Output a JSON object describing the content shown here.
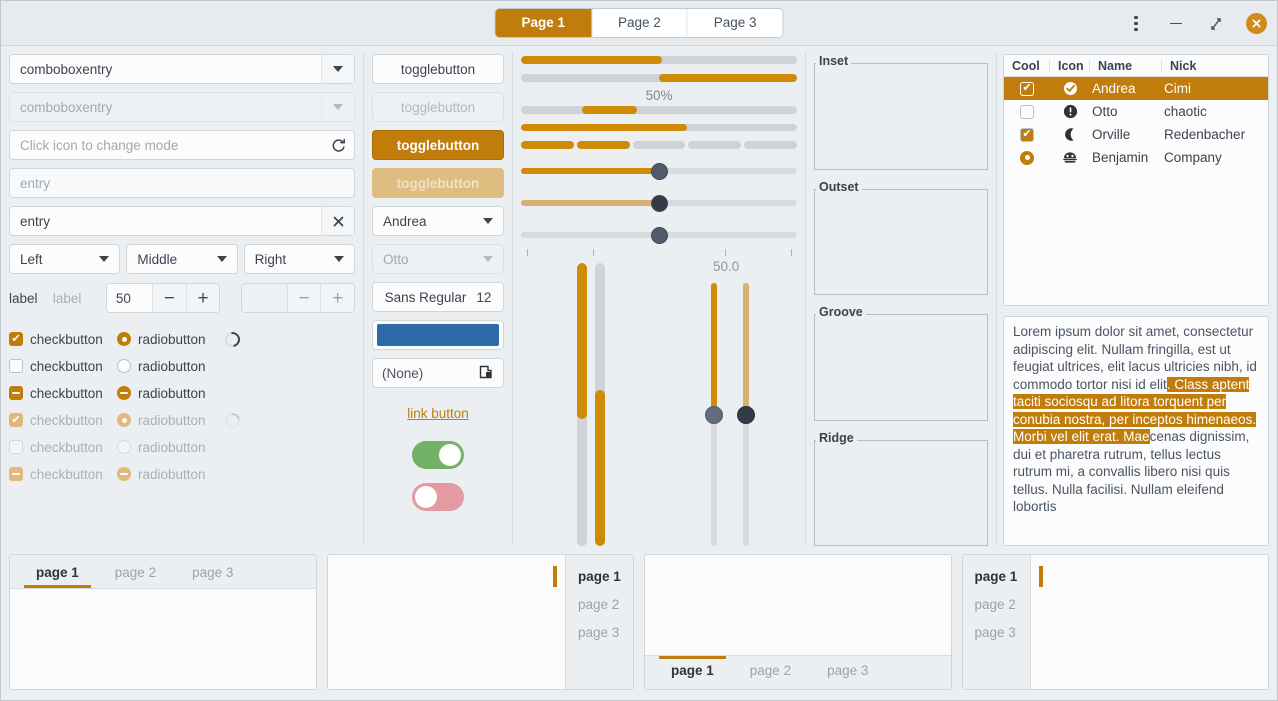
{
  "header": {
    "tabs": [
      {
        "label": "Page 1",
        "active": true
      },
      {
        "label": "Page 2",
        "active": false
      },
      {
        "label": "Page 3",
        "active": false
      }
    ],
    "menu_icon": "three-dots-icon",
    "minimize_icon": "minimize-icon",
    "restore_icon": "restore-icon",
    "close_icon": "close-icon"
  },
  "colors": {
    "accent": "#c17d0b",
    "accent_progress": "#cf8a08",
    "accent_faded": "#dfba7a",
    "window_bg": "#eceff2",
    "switch_on": "#72b266",
    "switch_off": "#e49aa3",
    "color_swatch": "#2d6aa8",
    "handle": "#505a6b",
    "handle_dark": "#343b47"
  },
  "column1": {
    "combo1": {
      "value": "comboboxentry",
      "icon": "chevron-down-icon"
    },
    "combo2": {
      "value": "comboboxentry",
      "icon": "chevron-down-icon"
    },
    "mode_entry": {
      "placeholder": "Click icon to change mode",
      "icon": "refresh-icon"
    },
    "entry_empty": {
      "placeholder": "entry"
    },
    "entry_filled": {
      "value": "entry",
      "icon": "clear-icon"
    },
    "aligned_combos": [
      {
        "label": "Left"
      },
      {
        "label": "Middle"
      },
      {
        "label": "Right"
      }
    ],
    "label1": "label",
    "label2": "label",
    "spin1": {
      "value": "50",
      "minus": "−",
      "plus": "+"
    },
    "spin2": {
      "value": "",
      "minus": "−",
      "plus": "+"
    },
    "check_rows": [
      {
        "check": {
          "state": "checked",
          "label": "checkbutton",
          "faded": false
        },
        "radio": {
          "state": "checked",
          "label": "radiobutton",
          "faded": false
        },
        "spinner": true,
        "spinner_faded": false
      },
      {
        "check": {
          "state": "unchecked",
          "label": "checkbutton",
          "faded": false
        },
        "radio": {
          "state": "unchecked",
          "label": "radiobutton",
          "faded": false
        },
        "spinner": false,
        "spinner_faded": false
      },
      {
        "check": {
          "state": "mixed",
          "label": "checkbutton",
          "faded": false
        },
        "radio": {
          "state": "mixed",
          "label": "radiobutton",
          "faded": false
        },
        "spinner": false,
        "spinner_faded": false
      },
      {
        "check": {
          "state": "checked",
          "label": "checkbutton",
          "faded": true
        },
        "radio": {
          "state": "checked",
          "label": "radiobutton",
          "faded": true
        },
        "spinner": true,
        "spinner_faded": true
      },
      {
        "check": {
          "state": "unchecked",
          "label": "checkbutton",
          "faded": true
        },
        "radio": {
          "state": "unchecked",
          "label": "radiobutton",
          "faded": true
        },
        "spinner": false,
        "spinner_faded": false
      },
      {
        "check": {
          "state": "mixed",
          "label": "checkbutton",
          "faded": true
        },
        "radio": {
          "state": "mixed",
          "label": "radiobutton",
          "faded": true
        },
        "spinner": false,
        "spinner_faded": false
      }
    ]
  },
  "column2": {
    "toggles": [
      {
        "label": "togglebutton",
        "style": "normal"
      },
      {
        "label": "togglebutton",
        "style": "insensitive"
      },
      {
        "label": "togglebutton",
        "style": "active"
      },
      {
        "label": "togglebutton",
        "style": "active-insensitive"
      }
    ],
    "combo_andrea": {
      "value": "Andrea",
      "icon": "chevron-down-icon"
    },
    "combo_otto": {
      "value": "Otto",
      "icon": "chevron-down-icon"
    },
    "font_button": {
      "family": "Sans Regular",
      "size": "12"
    },
    "color_button": {
      "icon": "color-swatch"
    },
    "file_button": {
      "label": "(None)",
      "icon": "file-picker-icon"
    },
    "link_button": {
      "label": "link button"
    },
    "switch_on": {
      "state": "on"
    },
    "switch_off": {
      "state": "off"
    }
  },
  "column3": {
    "progress_bars": [
      {
        "name": "progress-ltr",
        "value": 51,
        "direction": "ltr"
      },
      {
        "name": "progress-rtl",
        "value": 50,
        "direction": "rtl"
      }
    ],
    "percent_label": "50%",
    "progress_pulse": {
      "name": "progress-pulse",
      "start": 22,
      "width": 20
    },
    "progress_third": {
      "name": "progress-thin",
      "value": 60
    },
    "level_bar": {
      "segments": 5,
      "filled": 2
    },
    "scales": [
      {
        "name": "scale-normal",
        "value": 50,
        "fill": true,
        "handle": "normal"
      },
      {
        "name": "scale-insensitive",
        "value": 50,
        "fill": true,
        "handle": "dark",
        "faded": true
      },
      {
        "name": "scale-marks",
        "value": 50,
        "fill": false,
        "handle": "normal",
        "marks": [
          2,
          26,
          74,
          98
        ]
      }
    ],
    "vertical_progress": [
      {
        "name": "vprogress-top",
        "value": 55,
        "from": "top"
      },
      {
        "name": "vprogress-bottom",
        "value": 55,
        "from": "bottom"
      }
    ],
    "vscale_label": "50.0",
    "vertical_scales": [
      {
        "name": "vscale-normal",
        "value": 50,
        "handle": "normal"
      },
      {
        "name": "vscale-insensitive",
        "value": 50,
        "handle": "dark",
        "faded": true
      }
    ]
  },
  "frames": [
    {
      "label": "Inset",
      "name": "frame-inset"
    },
    {
      "label": "Outset",
      "name": "frame-outset"
    },
    {
      "label": "Groove",
      "name": "frame-groove"
    },
    {
      "label": "Ridge",
      "name": "frame-ridge"
    }
  ],
  "listview": {
    "columns": [
      "Cool",
      "Icon",
      "Name",
      "Nick"
    ],
    "rows": [
      {
        "cool": "checked",
        "icon": "check-circle-icon",
        "glyph": "✔",
        "name": "Andrea",
        "nick": "Cimi",
        "selected": true
      },
      {
        "cool": "unchecked",
        "icon": "warning-icon",
        "glyph": "!",
        "name": "Otto",
        "nick": "chaotic",
        "selected": false
      },
      {
        "cool": "checked",
        "icon": "moon-icon",
        "glyph": "☾",
        "name": "Orville",
        "nick": "Redenbacher",
        "selected": false
      },
      {
        "cool": "radio",
        "icon": "face-icon",
        "glyph": "☻",
        "name": "Benjamin",
        "nick": "Company",
        "selected": false
      }
    ]
  },
  "textview": {
    "before_selection": "Lorem ipsum dolor sit amet, consectetur adipiscing elit.\nNullam fringilla, est ut feugiat ultrices, elit lacus ultricies nibh, id commodo tortor nisi id elit",
    "selection": ".\nClass aptent taciti sociosqu ad litora torquent per conubia nostra, per inceptos himenaeos.\nMorbi vel elit erat. Mae",
    "after_selection": "cenas dignissim, dui et pharetra rutrum, tellus lectus rutrum mi, a convallis libero nisi quis tellus.\nNulla facilisi. Nullam eleifend lobortis"
  },
  "notebooks": [
    {
      "name": "notebook-tabs-top",
      "position": "top",
      "tabs": [
        {
          "label": "page 1",
          "active": true
        },
        {
          "label": "page 2",
          "active": false
        },
        {
          "label": "page 3",
          "active": false
        }
      ]
    },
    {
      "name": "notebook-tabs-right",
      "position": "right",
      "tabs": [
        {
          "label": "page 1",
          "active": true
        },
        {
          "label": "page 2",
          "active": false
        },
        {
          "label": "page 3",
          "active": false
        }
      ]
    },
    {
      "name": "notebook-tabs-bottom",
      "position": "bottom",
      "tabs": [
        {
          "label": "page 1",
          "active": true
        },
        {
          "label": "page 2",
          "active": false
        },
        {
          "label": "page 3",
          "active": false
        }
      ]
    },
    {
      "name": "notebook-tabs-left",
      "position": "left",
      "tabs": [
        {
          "label": "page 1",
          "active": true
        },
        {
          "label": "page 2",
          "active": false
        },
        {
          "label": "page 3",
          "active": false
        }
      ]
    }
  ]
}
